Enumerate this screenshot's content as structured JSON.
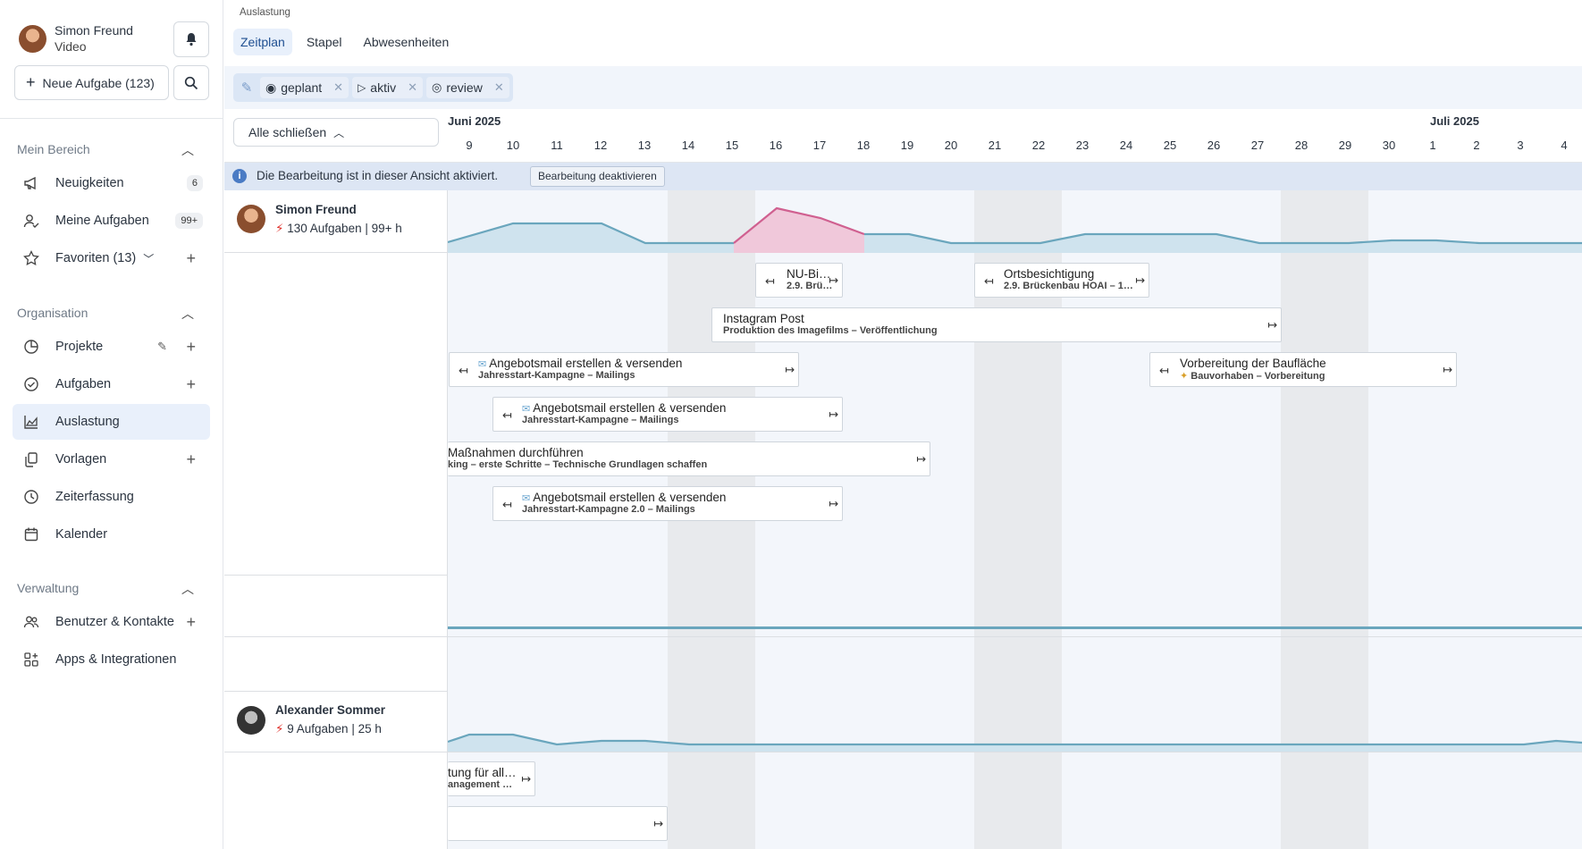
{
  "user": {
    "name": "Simon Freund",
    "role": "Video"
  },
  "new_task_label": "Neue Aufgabe (123)",
  "sections": {
    "mein_bereich": "Mein Bereich",
    "organisation": "Organisation",
    "verwaltung": "Verwaltung"
  },
  "nav": {
    "neuigkeiten": {
      "label": "Neuigkeiten",
      "badge": "6"
    },
    "meine_aufgaben": {
      "label": "Meine Aufgaben",
      "badge": "99+"
    },
    "favoriten": {
      "label": "Favoriten (13)"
    },
    "projekte": {
      "label": "Projekte"
    },
    "aufgaben": {
      "label": "Aufgaben"
    },
    "auslastung": {
      "label": "Auslastung"
    },
    "vorlagen": {
      "label": "Vorlagen"
    },
    "zeiterfassung": {
      "label": "Zeiterfassung"
    },
    "kalender": {
      "label": "Kalender"
    },
    "benutzer": {
      "label": "Benutzer & Kontakte"
    },
    "apps": {
      "label": "Apps & Integrationen"
    }
  },
  "page": {
    "breadcrumb": "Auslastung",
    "tabs": [
      "Zeitplan",
      "Stapel",
      "Abwesenheiten"
    ],
    "active_tab": "Zeitplan",
    "filters": [
      "geplant",
      "aktiv",
      "review"
    ],
    "close_all": "Alle schließen",
    "info_text": "Die Bearbeitung ist in dieser Ansicht aktiviert.",
    "disable_edit": "Bearbeitung deaktivieren"
  },
  "timeline": {
    "month_labels": [
      "Juni 2025",
      "Juli 2025"
    ],
    "days": [
      "9",
      "10",
      "11",
      "12",
      "13",
      "14",
      "15",
      "16",
      "17",
      "18",
      "19",
      "20",
      "21",
      "22",
      "23",
      "24",
      "25",
      "26",
      "27",
      "28",
      "29",
      "30",
      "1",
      "2",
      "3",
      "4"
    ]
  },
  "people": [
    {
      "name": "Simon Freund",
      "stats": "130 Aufgaben | 99+ h"
    },
    {
      "name": "Alexander Sommer",
      "stats": "9 Aufgaben | 25 h"
    }
  ],
  "tasks": [
    {
      "title": "NU-Bi…",
      "sub": "2.9. Brü…"
    },
    {
      "title": "Ortsbesichtigung",
      "sub": "2.9. Brückenbau HOAI – 1…"
    },
    {
      "title": "Instagram Post",
      "sub": "Produktion des Imagefilms – Veröffentlichung"
    },
    {
      "title": "Angebotsmail erstellen & versenden",
      "sub": "Jahresstart-Kampagne – Mailings"
    },
    {
      "title": "Vorbereitung der Baufläche",
      "sub": "Bauvorhaben – Vorbereitung"
    },
    {
      "title": "Angebotsmail erstellen & versenden",
      "sub": "Jahresstart-Kampagne – Mailings"
    },
    {
      "title": "Maßnahmen durchführen",
      "sub": "king – erste Schritte – Technische Grundlagen schaffen"
    },
    {
      "title": "Angebotsmail erstellen & versenden",
      "sub": "Jahresstart-Kampagne 2.0 – Mailings"
    },
    {
      "title": "tung für all…",
      "sub": "anagement …"
    },
    {
      "title": "",
      "sub": ""
    }
  ],
  "colors": {
    "accent": "#1f4f91",
    "load_line": "#6aa6bd",
    "overload": "#d06090",
    "shade": "#e8eaed"
  }
}
